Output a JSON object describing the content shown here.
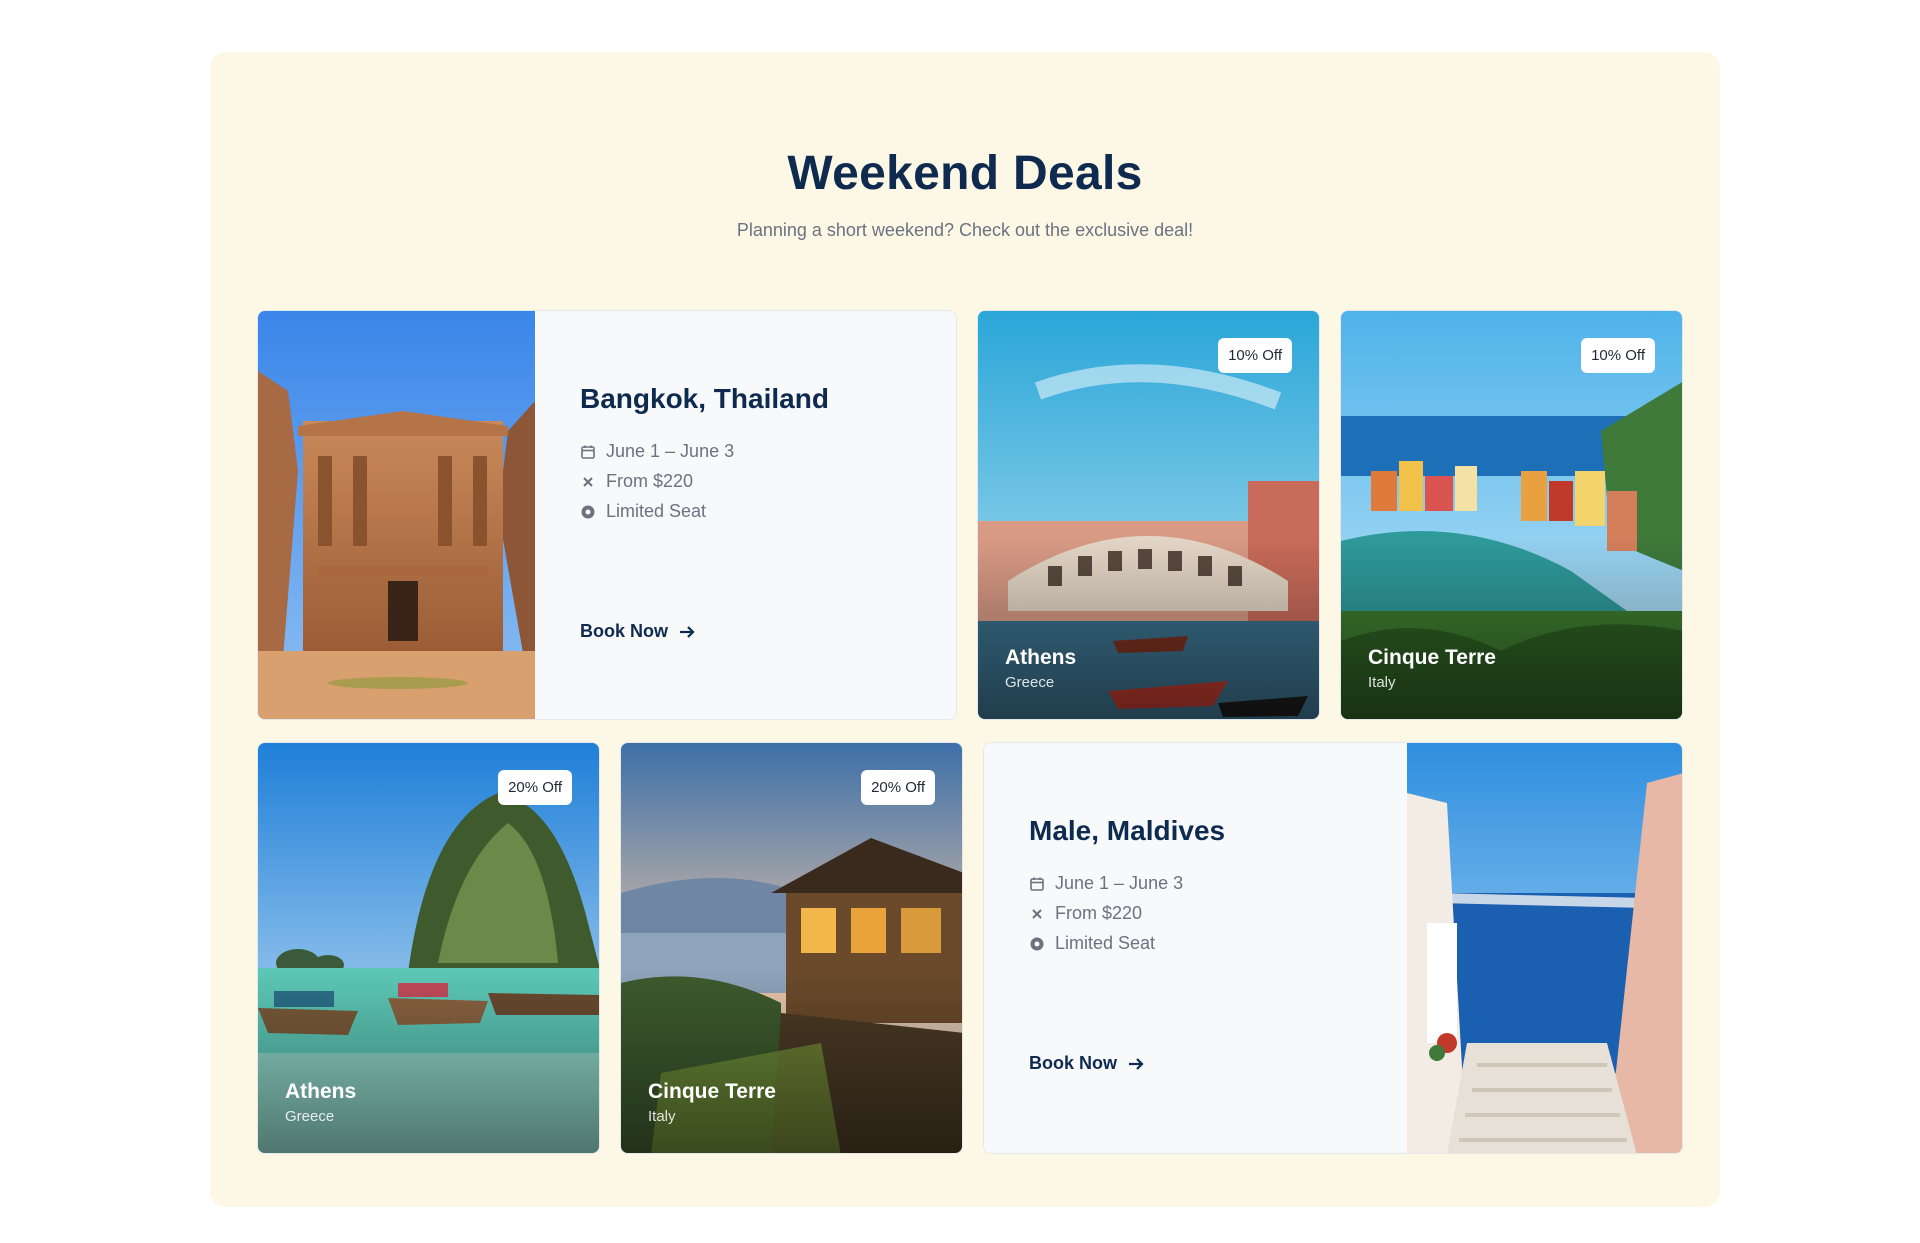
{
  "header": {
    "title": "Weekend Deals",
    "subtitle": "Planning a short weekend? Check out the exclusive deal!"
  },
  "featured_cards": [
    {
      "title": "Bangkok, Thailand",
      "dates": "June 1 – June 3",
      "price": "From $220",
      "availability": "Limited Seat",
      "cta": "Book Now",
      "icons": [
        "calendar-icon",
        "close-icon",
        "circle-dot-icon",
        "arrow-right-icon"
      ]
    },
    {
      "title": "Male, Maldives",
      "dates": "June 1 – June 3",
      "price": "From $220",
      "availability": "Limited Seat",
      "cta": "Book Now",
      "icons": [
        "calendar-icon",
        "close-icon",
        "circle-dot-icon",
        "arrow-right-icon"
      ]
    }
  ],
  "deal_cards": [
    {
      "city": "Athens",
      "country": "Greece",
      "badge": "10% Off"
    },
    {
      "city": "Cinque Terre",
      "country": "Italy",
      "badge": "10% Off"
    },
    {
      "city": "Athens",
      "country": "Greece",
      "badge": "20% Off"
    },
    {
      "city": "Cinque Terre",
      "country": "Italy",
      "badge": "20% Off"
    }
  ],
  "colors": {
    "panel_background": "#fdf8e6",
    "title": "#0e2a4f",
    "muted_text": "#6b7280",
    "info_card_background": "#f7f9fb"
  }
}
